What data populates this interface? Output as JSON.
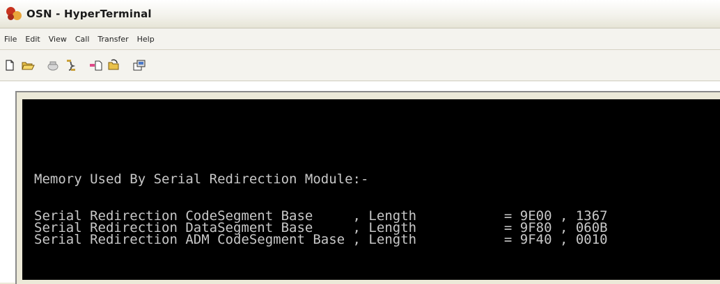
{
  "window": {
    "title": "OSN - HyperTerminal"
  },
  "menubar": {
    "items": [
      "File",
      "Edit",
      "View",
      "Call",
      "Transfer",
      "Help"
    ]
  },
  "toolbar": {
    "buttons": [
      "new-connection-icon",
      "open-icon",
      "call-icon",
      "disconnect-icon",
      "send-file-icon",
      "receive-file-icon",
      "properties-icon"
    ]
  },
  "terminal": {
    "heading": "Memory Used By Serial Redirection Module:-",
    "lines": [
      "Serial Redirection CodeSegment Base     , Length           = 9E00 , 1367",
      "Serial Redirection DataSegment Base     , Length           = 9F80 , 060B",
      "Serial Redirection ADM CodeSegment Base , Length           = 9F40 , 0010"
    ]
  }
}
